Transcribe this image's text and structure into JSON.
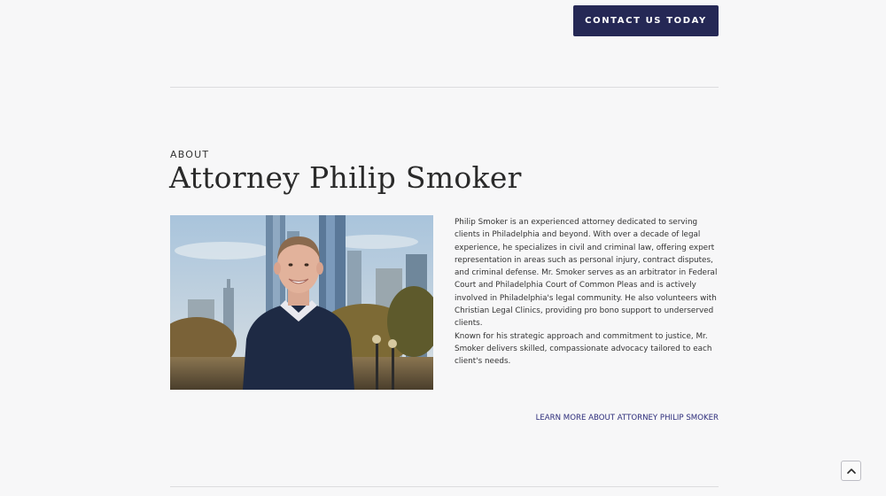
{
  "header": {
    "cta_label": "CONTACT US TODAY"
  },
  "about": {
    "eyebrow": "ABOUT",
    "title": "Attorney Philip Smoker",
    "photo_alt": "Attorney Philip Smoker portrait with Philadelphia skyline",
    "bio_paragraphs": [
      "Philip Smoker is an experienced attorney dedicated to serving clients in Philadelphia and beyond. With over a decade of legal experience, he specializes in civil and criminal law, offering expert representation in areas such as personal injury, contract disputes, and criminal defense. Mr. Smoker serves as an arbitrator in Federal Court and Philadelphia Court of Common Pleas and is actively involved in Philadelphia's legal community. He also volunteers with Christian Legal Clinics, providing pro bono support to underserved clients.",
      "Known for his strategic approach and commitment to justice, Mr. Smoker delivers skilled, compassionate advocacy tailored to each client's needs."
    ],
    "learn_more_label": "LEARN MORE ABOUT ATTORNEY PHILIP SMOKER"
  },
  "scroll_top": {
    "icon": "chevron-up-icon"
  },
  "colors": {
    "background": "#f7f7f8",
    "cta_background": "#252855",
    "link": "#2c2c7a",
    "divider": "#dcdcdf"
  }
}
